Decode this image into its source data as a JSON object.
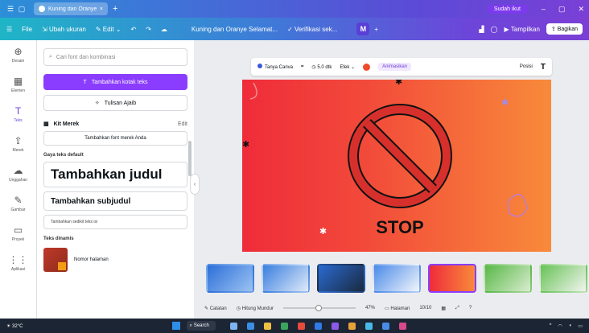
{
  "tabbar": {
    "tab_title": "Kuning dan Oranye...",
    "upgrade_label": "Sudah ikut"
  },
  "menubar": {
    "home": "File",
    "resize": "Ubah ukuran",
    "edit": "Edit",
    "doc_title": "Kuning dan Oranye Selamat...",
    "verify": "Verifikasi sek...",
    "avatar_letter": "M",
    "present": "Tampilkan",
    "share": "Bagikan"
  },
  "rail": [
    {
      "icon": "⊕",
      "label": "Desain"
    },
    {
      "icon": "▦",
      "label": "Elemen"
    },
    {
      "icon": "T",
      "label": "Teks"
    },
    {
      "icon": "⇪",
      "label": "Merek"
    },
    {
      "icon": "☁",
      "label": "Unggahan"
    },
    {
      "icon": "✎",
      "label": "Gambar"
    },
    {
      "icon": "▭",
      "label": "Proyek"
    },
    {
      "icon": "⋮⋮",
      "label": "Aplikasi"
    }
  ],
  "panel": {
    "search_placeholder": "Cari font dan kombinasi",
    "add_text_button": "Tambahkan kotak teks",
    "magic_write_button": "Tulisan Ajaib",
    "brand_kit_title": "Kit Merek",
    "brand_kit_edit": "Edit",
    "brand_kit_add": "Tambahkan font merek Anda",
    "default_styles": "Gaya teks default",
    "heading": "Tambahkan judul",
    "subheading": "Tambahkan subjudul",
    "body": "Tambahkan sedikit teks isi",
    "combos_title": "Teks dinamis",
    "combo_label": "Nomor halaman"
  },
  "toolbar": {
    "font": "Tanya Canva",
    "timer": "5.0 dtk",
    "effects": "Efek",
    "animate": "Animasikan",
    "position": "Posisi"
  },
  "canvas": {
    "stop_text": "STOP"
  },
  "status": {
    "notes": "Catatan",
    "timer": "Hitung Mundur",
    "zoom": "47%",
    "pages": "Halaman",
    "page_count": "10/10"
  },
  "taskbar": {
    "temp": "32°C",
    "search": "Search"
  },
  "colors": {
    "accent": "#8b3dff",
    "canvas_left": "#ef2c3a",
    "canvas_right": "#f88a3a"
  }
}
